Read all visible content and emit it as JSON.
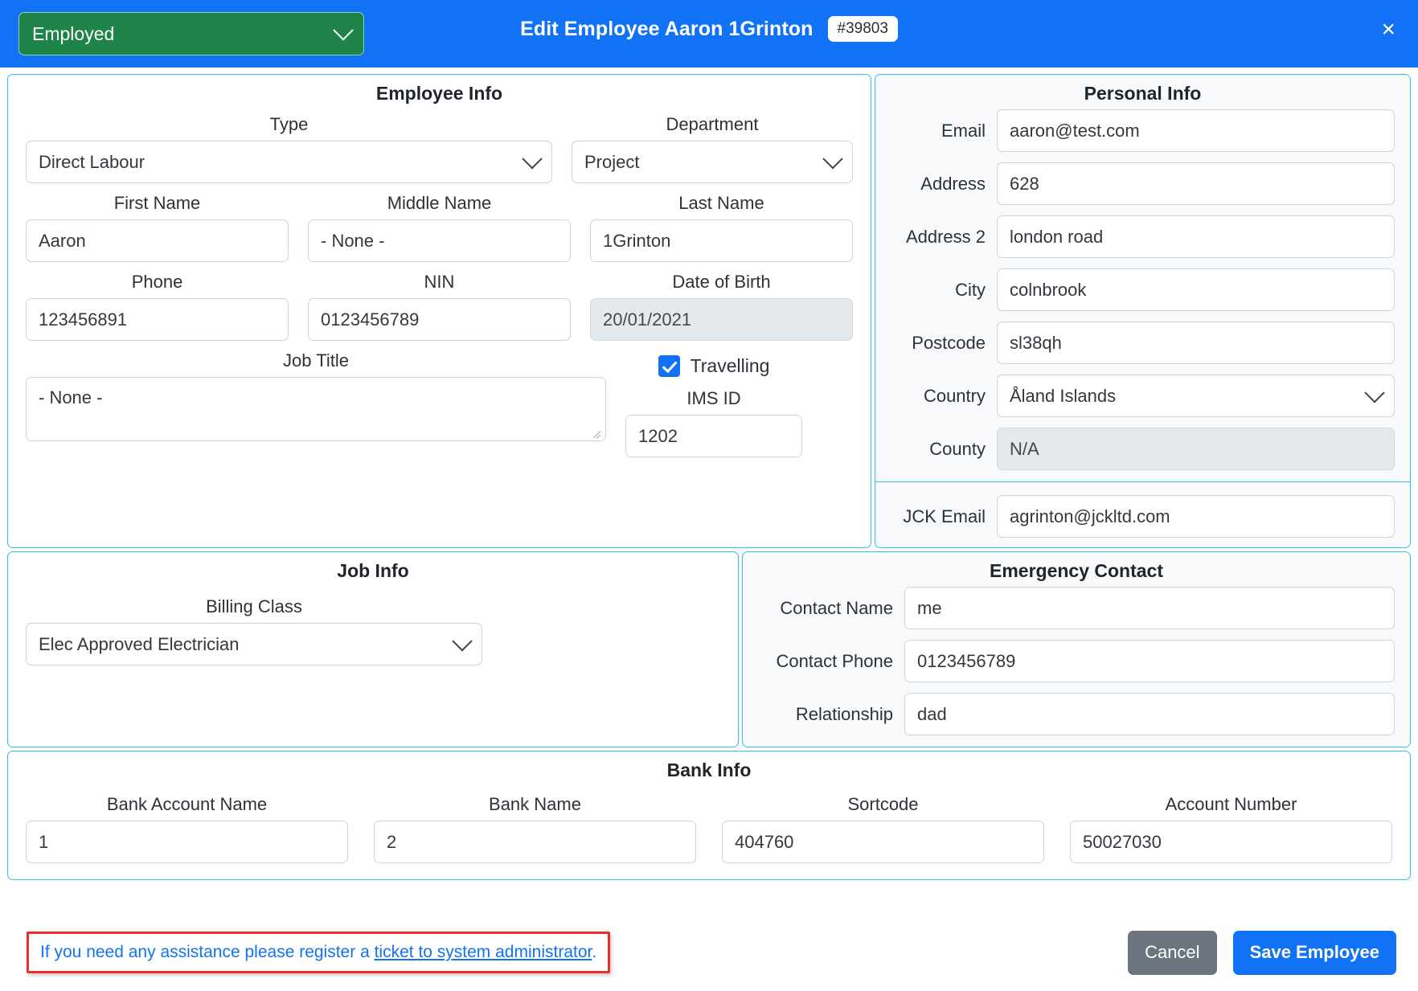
{
  "header": {
    "status_value": "Employed",
    "title": "Edit Employee Aaron 1Grinton",
    "id_badge": "#39803",
    "close_label": "×",
    "bg_color": "#1272f5",
    "status_color": "#1e8449"
  },
  "employee_info": {
    "section_title": "Employee Info",
    "type_label": "Type",
    "type_value": "Direct Labour",
    "department_label": "Department",
    "department_value": "Project",
    "first_name_label": "First Name",
    "first_name_value": "Aaron",
    "middle_name_label": "Middle Name",
    "middle_name_value": "- None -",
    "last_name_label": "Last Name",
    "last_name_value": "1Grinton",
    "phone_label": "Phone",
    "phone_value": "123456891",
    "nin_label": "NIN",
    "nin_value": "0123456789",
    "dob_label": "Date of Birth",
    "dob_value": "20/01/2021",
    "job_title_label": "Job Title",
    "job_title_value": "- None -",
    "travelling_label": "Travelling",
    "travelling_checked": true,
    "ims_id_label": "IMS ID",
    "ims_id_value": "1202"
  },
  "personal_info": {
    "section_title": "Personal Info",
    "rows": [
      {
        "label": "Email",
        "value": "aaron@test.com",
        "type": "text"
      },
      {
        "label": "Address",
        "value": "628",
        "type": "text"
      },
      {
        "label": "Address 2",
        "value": "london road",
        "type": "text"
      },
      {
        "label": "City",
        "value": "colnbrook",
        "type": "text"
      },
      {
        "label": "Postcode",
        "value": "sl38qh",
        "type": "text"
      },
      {
        "label": "Country",
        "value": "Åland Islands",
        "type": "select"
      },
      {
        "label": "County",
        "value": "N/A",
        "type": "disabled"
      }
    ],
    "jck_email_label": "JCK Email",
    "jck_email_value": "agrinton@jckltd.com"
  },
  "job_info": {
    "section_title": "Job Info",
    "billing_class_label": "Billing Class",
    "billing_class_value": "Elec Approved Electrician"
  },
  "emergency_contact": {
    "section_title": "Emergency Contact",
    "rows": [
      {
        "label": "Contact Name",
        "value": "me"
      },
      {
        "label": "Contact Phone",
        "value": "0123456789"
      },
      {
        "label": "Relationship",
        "value": "dad"
      }
    ]
  },
  "bank_info": {
    "section_title": "Bank Info",
    "fields": [
      {
        "label": "Bank Account Name",
        "value": "1"
      },
      {
        "label": "Bank Name",
        "value": "2"
      },
      {
        "label": "Sortcode",
        "value": "404760"
      },
      {
        "label": "Account Number",
        "value": "50027030"
      }
    ]
  },
  "footer": {
    "assist_prefix": "If you need any assistance please register a ",
    "assist_link": "ticket to system administrator",
    "assist_suffix": ".",
    "cancel_label": "Cancel",
    "save_label": "Save Employee"
  }
}
